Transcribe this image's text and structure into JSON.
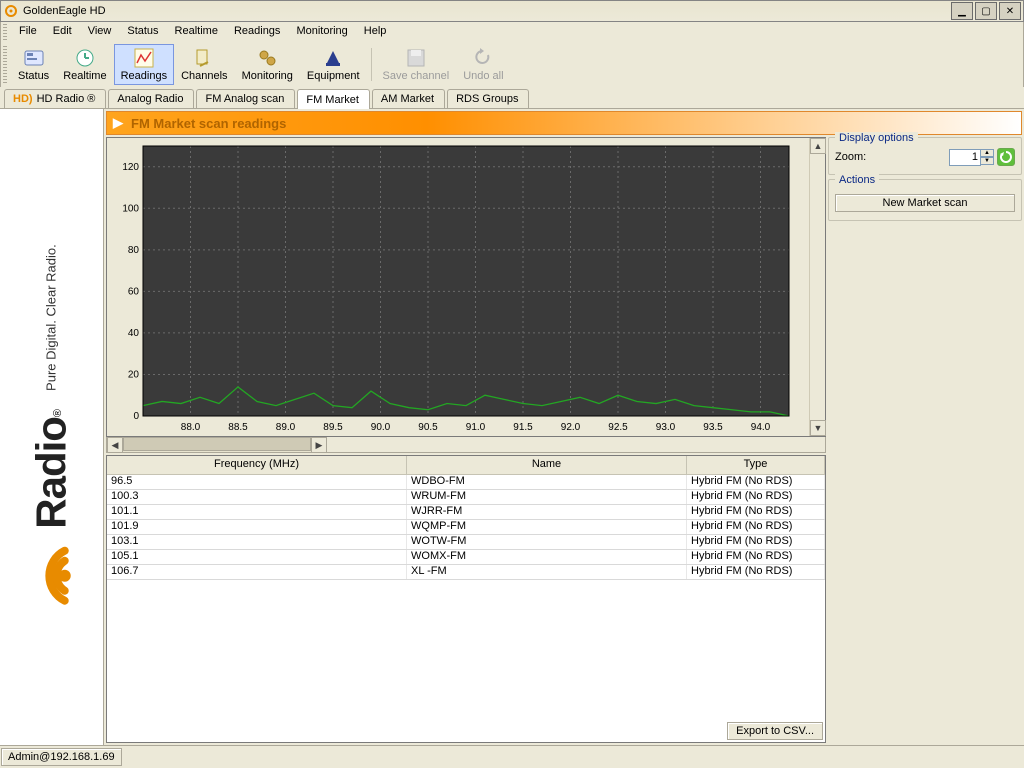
{
  "window": {
    "title": "GoldenEagle HD"
  },
  "menu": {
    "file": "File",
    "edit": "Edit",
    "view": "View",
    "status": "Status",
    "realtime": "Realtime",
    "readings": "Readings",
    "monitoring": "Monitoring",
    "help": "Help"
  },
  "toolbar": {
    "status": "Status",
    "realtime": "Realtime",
    "readings": "Readings",
    "channels": "Channels",
    "monitoring": "Monitoring",
    "equipment": "Equipment",
    "save": "Save channel",
    "undo": "Undo all"
  },
  "tabs": {
    "hd": "HD Radio ®",
    "analog": "Analog Radio",
    "fmanalog": "FM Analog scan",
    "fmmarket": "FM Market",
    "ammarket": "AM Market",
    "rds": "RDS Groups"
  },
  "header": "FM Market scan readings",
  "display": {
    "panel": "Display options",
    "zoom_label": "Zoom:",
    "zoom_value": "1"
  },
  "actions": {
    "panel": "Actions",
    "newscan": "New Market scan"
  },
  "table": {
    "cols": {
      "freq": "Frequency (MHz)",
      "name": "Name",
      "type": "Type"
    },
    "rows": [
      {
        "freq": "96.5",
        "name": "WDBO-FM",
        "type": "Hybrid FM (No RDS)"
      },
      {
        "freq": "100.3",
        "name": "WRUM-FM",
        "type": "Hybrid FM (No RDS)"
      },
      {
        "freq": "101.1",
        "name": "WJRR-FM",
        "type": "Hybrid FM (No RDS)"
      },
      {
        "freq": "101.9",
        "name": "WQMP-FM",
        "type": "Hybrid FM (No RDS)"
      },
      {
        "freq": "103.1",
        "name": "WOTW-FM",
        "type": "Hybrid FM (No RDS)"
      },
      {
        "freq": "105.1",
        "name": "WOMX-FM",
        "type": "Hybrid FM (No RDS)"
      },
      {
        "freq": "106.7",
        "name": "XL  -FM",
        "type": "Hybrid FM (No RDS)"
      }
    ]
  },
  "export": "Export to CSV...",
  "status": "Admin@192.168.1.69",
  "brand": {
    "big": "Radio",
    "reg": "®",
    "sub": "Pure Digital. Clear Radio."
  },
  "chart_data": {
    "type": "line",
    "title": "",
    "xlabel": "",
    "ylabel": "",
    "ylim": [
      0,
      130
    ],
    "yticks": [
      0,
      20,
      40,
      60,
      80,
      100,
      120
    ],
    "xticks": [
      "88.0",
      "88.5",
      "89.0",
      "89.5",
      "90.0",
      "90.5",
      "91.0",
      "91.5",
      "92.0",
      "92.5",
      "93.0",
      "93.5",
      "94.0"
    ],
    "x": [
      87.5,
      87.7,
      87.9,
      88.1,
      88.3,
      88.5,
      88.7,
      88.9,
      89.1,
      89.3,
      89.5,
      89.7,
      89.9,
      90.1,
      90.3,
      90.5,
      90.7,
      90.9,
      91.1,
      91.3,
      91.5,
      91.7,
      91.9,
      92.1,
      92.3,
      92.5,
      92.7,
      92.9,
      93.1,
      93.3,
      93.5,
      93.7,
      93.9,
      94.1,
      94.3
    ],
    "values": [
      5,
      7,
      6,
      9,
      6,
      14,
      7,
      5,
      8,
      11,
      5,
      4,
      12,
      6,
      4,
      3,
      6,
      5,
      10,
      8,
      6,
      5,
      7,
      9,
      6,
      10,
      7,
      6,
      8,
      5,
      4,
      3,
      2,
      2,
      0
    ],
    "series_color": "#23a623"
  }
}
